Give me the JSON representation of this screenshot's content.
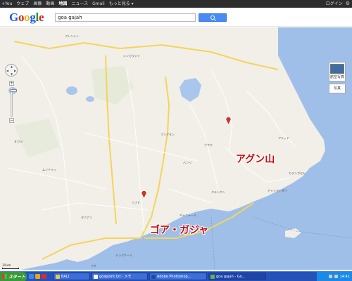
{
  "top_nav": {
    "links": [
      "+You",
      "ウェブ",
      "画像",
      "動画",
      "地図",
      "ニュース",
      "Gmail",
      "もっと見る ▾"
    ],
    "active_index": 4,
    "signin": "ログイン",
    "gear_icon": "gear-icon"
  },
  "header": {
    "logo": {
      "G": "G",
      "o1": "o",
      "o2": "o",
      "g": "g",
      "l": "l",
      "e": "e"
    },
    "search_value": "goa gajah",
    "search_icon": "search-icon"
  },
  "map": {
    "controls": {
      "zoom_in": "+",
      "zoom_out": "−",
      "satellite_label": "航空写真",
      "photo_label": "写真"
    },
    "annotations": {
      "agung": "アグン山",
      "goa": "ゴア・ガジャ"
    },
    "place_labels": [
      "デンパサール",
      "クタ",
      "ウブド",
      "ギャニャール",
      "バンリ",
      "ブサキ",
      "クルンクン",
      "アメッド",
      "シンガラジャ",
      "カランガセム",
      "チャンディダサ",
      "タバナン",
      "プレンレン",
      "ブリアタン",
      "ムンドゥッ",
      "ヌガラ"
    ],
    "scale_text": "10 km"
  },
  "taskbar": {
    "start_label": "スタート",
    "tasks": [
      "BALI",
      "goapoint.txt - メモ",
      "Adobe Photoshop...",
      "goa gajah - Go..."
    ],
    "active_task_index": 3,
    "tray_time": "14:41"
  }
}
